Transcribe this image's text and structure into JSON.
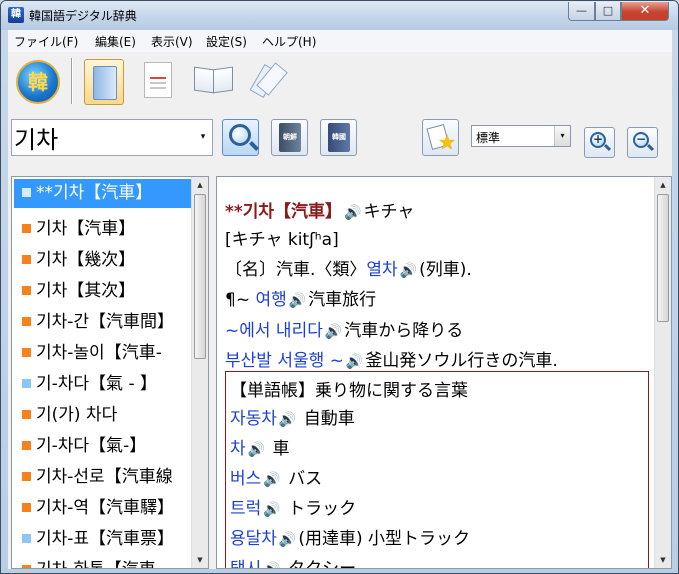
{
  "window": {
    "title": "韓国語デジタル辞典",
    "icon_label": "韓",
    "minimize_glyph": "—",
    "maximize_glyph": "□",
    "close_glyph": "✕"
  },
  "menu": [
    "ファイル(F)",
    "編集(E)",
    "表示(V)",
    "設定(S)",
    "ヘルプ(H)"
  ],
  "toolbar": {
    "logo_text": "韓",
    "dict1_label": "朝鮮",
    "dict2_label": "韓國"
  },
  "search": {
    "query": "기차",
    "dropdown_glyph": "▾"
  },
  "style_select": {
    "value": "標準",
    "arrow": "▾"
  },
  "zoom": {
    "in_sign": "+",
    "out_sign": "−"
  },
  "wordlist": {
    "items": [
      {
        "text": "**기차【汽車】",
        "bullet": "white",
        "selected": true
      },
      {
        "text": "기차【汽車】",
        "bullet": "orange"
      },
      {
        "text": "기차【幾次】",
        "bullet": "orange"
      },
      {
        "text": "기차【其次】",
        "bullet": "orange"
      },
      {
        "text": "기차-간【汽車間】",
        "bullet": "orange"
      },
      {
        "text": "기차-놀이【汽車-",
        "bullet": "orange"
      },
      {
        "text": "기-차다【氣 - 】",
        "bullet": "blue"
      },
      {
        "text": "기(가) 차다",
        "bullet": "orange"
      },
      {
        "text": "기-차다【氣-】",
        "bullet": "orange"
      },
      {
        "text": "기차-선로【汽車線",
        "bullet": "orange"
      },
      {
        "text": "기차-역【汽車驛】",
        "bullet": "orange"
      },
      {
        "text": "기차-표【汽車票】",
        "bullet": "blue"
      },
      {
        "text": "기차-화통【汽車",
        "bullet": "orange"
      }
    ]
  },
  "entry": {
    "headword": "**기차【汽車】",
    "headword_reading": "キチャ",
    "pronunciation": "[キチャ kitʃʰa]",
    "pos_prefix": "〔名〕汽車.〈類〉",
    "synonym": "열차",
    "synonym_gloss": "(列車).",
    "ex1_prefix": "¶~ ",
    "ex1_kor": "여행",
    "ex1_jp": "汽車旅行",
    "ex2_kor": "~에서 내리다",
    "ex2_jp": "汽車から降りる",
    "ex3_kor": "부산발 서울행 ~",
    "ex3_jp": "釜山発ソウル行きの汽車.",
    "speaker_glyph": "🔊",
    "vocab": {
      "title": "【単語帳】乗り物に関する言葉",
      "items": [
        {
          "kor": "자동차",
          "jp": "自動車"
        },
        {
          "kor": "차",
          "jp": "車"
        },
        {
          "kor": "버스",
          "jp": "バス"
        },
        {
          "kor": "트럭",
          "jp": "トラック"
        },
        {
          "kor": "용달차",
          "jp": "(用達車) 小型トラック"
        },
        {
          "kor": "택시",
          "jp": "タクシー"
        }
      ]
    }
  },
  "scroll": {
    "up": "▲",
    "down": "▼"
  }
}
